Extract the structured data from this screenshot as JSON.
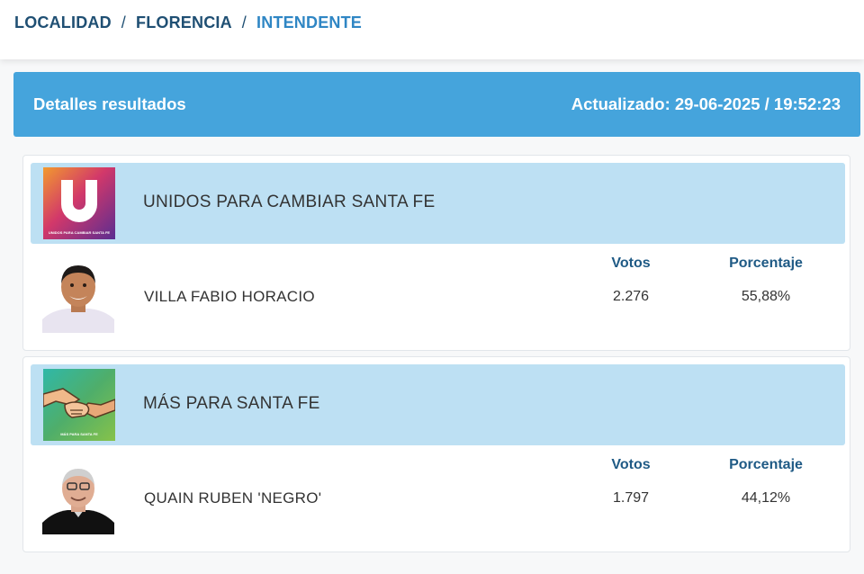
{
  "breadcrumb": {
    "items": [
      "LOCALIDAD",
      "FLORENCIA",
      "INTENDENTE"
    ],
    "separator": "/"
  },
  "header": {
    "title": "Detalles resultados",
    "updated": "Actualizado: 29-06-2025 / 19:52:23"
  },
  "results": [
    {
      "party": "UNIDOS PARA CAMBIAR SANTA FE",
      "party_logo_text": "UNIDOS PARA CAMBIAR SANTA FE",
      "candidate": "VILLA FABIO HORACIO",
      "votes_label": "Votos",
      "percent_label": "Porcentaje",
      "votes": "2.276",
      "percent": "55,88%"
    },
    {
      "party": "MÁS PARA SANTA FE",
      "party_logo_text": "MÁS PARA SANTA FE",
      "candidate": "QUAIN RUBEN 'NEGRO'",
      "votes_label": "Votos",
      "percent_label": "Porcentaje",
      "votes": "1.797",
      "percent": "44,12%"
    }
  ],
  "colors": {
    "header_bg": "#45a4dc",
    "party_row_bg": "#bde0f3",
    "breadcrumb": "#1f4f73",
    "breadcrumb_active": "#2f86c4",
    "label": "#1f5a85"
  },
  "icons": {
    "party1_logo": "unidos-logo",
    "party2_logo": "handshake-logo"
  }
}
